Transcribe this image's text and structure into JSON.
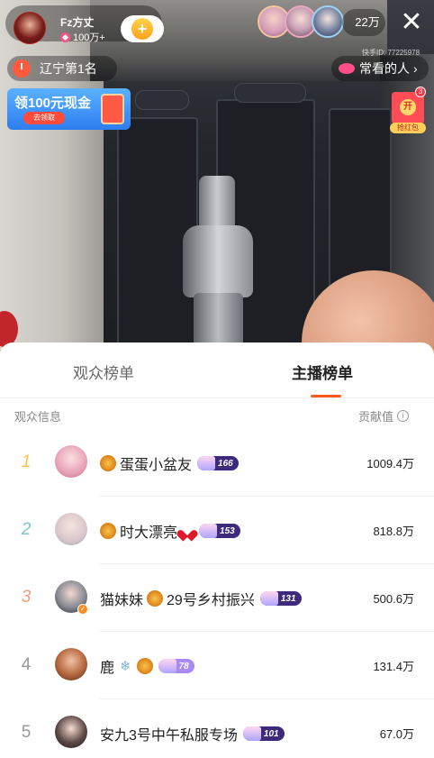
{
  "host": {
    "name": "Fz方丈",
    "likes": "100万+"
  },
  "viewer_count": "22万",
  "region_rank": "辽宁第1名",
  "kuaishou_id": "快手ID: 77225978",
  "often_watched": "常看的人",
  "cash_banner": {
    "title": "领100元现金",
    "cta": "去领取"
  },
  "red_packet": {
    "badge": "3",
    "coin": "开",
    "label": "抢红包"
  },
  "sheet": {
    "tab_audience": "观众榜单",
    "tab_anchor": "主播榜单",
    "col_left": "观众信息",
    "col_right": "贡献值",
    "info_glyph": "i"
  },
  "leaderboard": [
    {
      "rank": "1",
      "name": "蛋蛋小盆友",
      "level": "166",
      "score": "1009.4万"
    },
    {
      "rank": "2",
      "name": "时大漂亮",
      "level": "153",
      "score": "818.8万"
    },
    {
      "rank": "3",
      "name_prefix": "猫妹妹",
      "name": "29号乡村振兴",
      "level": "131",
      "score": "500.6万"
    },
    {
      "rank": "4",
      "name": "鹿",
      "level": "78",
      "score": "131.4万"
    },
    {
      "rank": "5",
      "name": "安九3号中午私服专场",
      "level": "101",
      "score": "67.0万"
    }
  ]
}
